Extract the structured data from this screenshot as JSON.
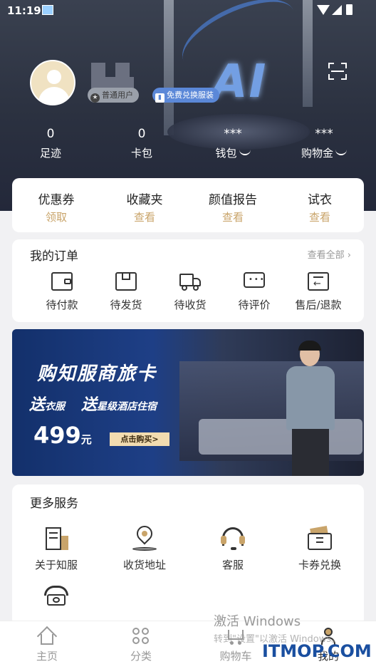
{
  "status_bar": {
    "time": "11:19"
  },
  "profile": {
    "badge_user": "普通用户",
    "badge_free": "免费兑换服装"
  },
  "stats": [
    {
      "value": "0",
      "label": "足迹"
    },
    {
      "value": "0",
      "label": "卡包"
    },
    {
      "value": "***",
      "label": "钱包"
    },
    {
      "value": "***",
      "label": "购物金"
    }
  ],
  "quick": [
    {
      "title": "优惠券",
      "action": "领取"
    },
    {
      "title": "收藏夹",
      "action": "查看"
    },
    {
      "title": "颜值报告",
      "action": "查看"
    },
    {
      "title": "试衣",
      "action": "查看"
    }
  ],
  "orders": {
    "title": "我的订单",
    "view_all": "查看全部 ›",
    "items": [
      {
        "label": "待付款",
        "icon": "wallet-icon"
      },
      {
        "label": "待发货",
        "icon": "box-icon"
      },
      {
        "label": "待收货",
        "icon": "truck-icon"
      },
      {
        "label": "待评价",
        "icon": "chat-icon"
      },
      {
        "label": "售后/退款",
        "icon": "return-icon"
      }
    ]
  },
  "banner": {
    "headline": "购知服商旅卡",
    "line_prefix1": "送",
    "line_item1": "衣服",
    "line_prefix2": "送",
    "line_item2": "星级酒店住宿",
    "price": "499",
    "price_unit": "元",
    "buy_label": "点击购买>"
  },
  "more": {
    "title": "更多服务",
    "items": [
      {
        "label": "关于知服",
        "icon": "building-icon"
      },
      {
        "label": "收货地址",
        "icon": "location-icon"
      },
      {
        "label": "客服",
        "icon": "headset-icon"
      },
      {
        "label": "卡券兑换",
        "icon": "coupon-icon"
      },
      {
        "label": "",
        "icon": "phone-icon"
      }
    ]
  },
  "tabbar": [
    {
      "label": "主页",
      "icon": "home-icon"
    },
    {
      "label": "分类",
      "icon": "category-icon"
    },
    {
      "label": "购物车",
      "icon": "cart-icon"
    },
    {
      "label": "我的",
      "icon": "profile-icon"
    }
  ],
  "overlay": {
    "activate_title": "激活 Windows",
    "activate_sub": "转到\"设置\"以激活 Windows。",
    "site": "ITMOP.COM"
  },
  "colors": {
    "accent_gold": "#c9a46a",
    "header_dark": "#2b3140",
    "banner_blue": "#1e3f86"
  }
}
